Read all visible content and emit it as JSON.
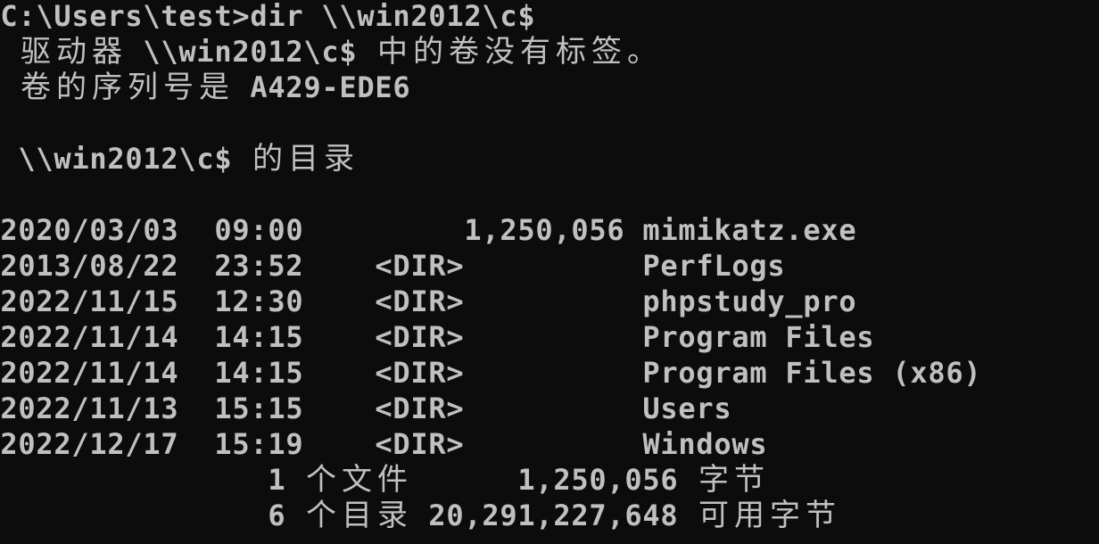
{
  "window": {
    "type": "command-prompt",
    "foreground": "#c0c0c0",
    "background": "#0c0c0c"
  },
  "lines": [
    "C:\\Users\\test>dir \\\\win2012\\c$",
    " 驱动器 \\\\win2012\\c$ 中的卷没有标签。",
    " 卷的序列号是 A429-EDE6",
    "",
    " \\\\win2012\\c$ 的目录",
    "",
    "2020/03/03  09:00         1,250,056 mimikatz.exe",
    "2013/08/22  23:52    <DIR>          PerfLogs",
    "2022/11/15  12:30    <DIR>          phpstudy_pro",
    "2022/11/14  14:15    <DIR>          Program Files",
    "2022/11/14  14:15    <DIR>          Program Files (x86)",
    "2022/11/13  15:15    <DIR>          Users",
    "2022/12/17  15:19    <DIR>          Windows",
    "               1 个文件      1,250,056 字节",
    "               6 个目录 20,291,227,648 可用字节"
  ]
}
